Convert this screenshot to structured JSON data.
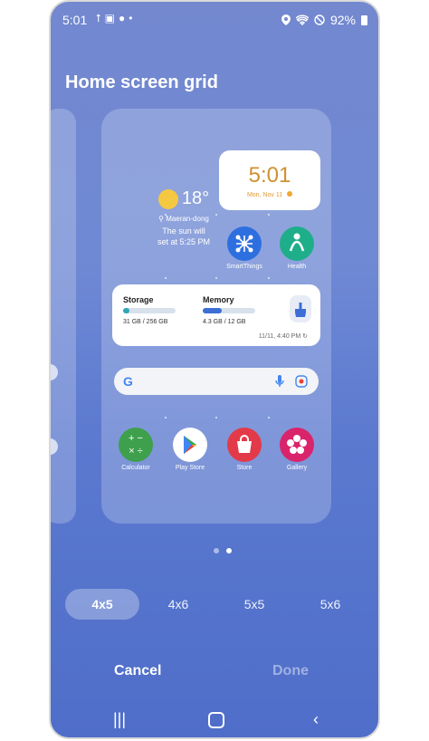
{
  "status": {
    "time": "5:01",
    "battery": "92%"
  },
  "title": "Home screen grid",
  "weather": {
    "temp": "18°",
    "location": "Maeran-dong",
    "line1": "The sun will",
    "line2": "set at 5:25 PM"
  },
  "clock": {
    "time": "5:01",
    "date": "Mon, Nov 11"
  },
  "apps_row1": [
    {
      "label": "SmartThings",
      "color": "#2e6fe0"
    },
    {
      "label": "Health",
      "color": "#1fae8a"
    }
  ],
  "storage": {
    "label": "Storage",
    "value": "31 GB / 256 GB",
    "fill": 0.12,
    "memory_label": "Memory",
    "memory_value": "4.3 GB / 12 GB",
    "memory_fill": 0.36,
    "timestamp": "11/11, 4:40 PM"
  },
  "apps_row2": [
    {
      "label": "Calculator",
      "color": "#3ea04d"
    },
    {
      "label": "Play Store",
      "color": "#ffffff"
    },
    {
      "label": "Store",
      "color": "#e33a49"
    },
    {
      "label": "Gallery",
      "color": "#d9246b"
    }
  ],
  "grid_options": [
    "4x5",
    "4x6",
    "5x5",
    "5x6"
  ],
  "selected_option": "4x5",
  "actions": {
    "cancel": "Cancel",
    "done": "Done"
  },
  "colors": {
    "accent": "#4f6ec9",
    "clock": "#cf9130"
  }
}
